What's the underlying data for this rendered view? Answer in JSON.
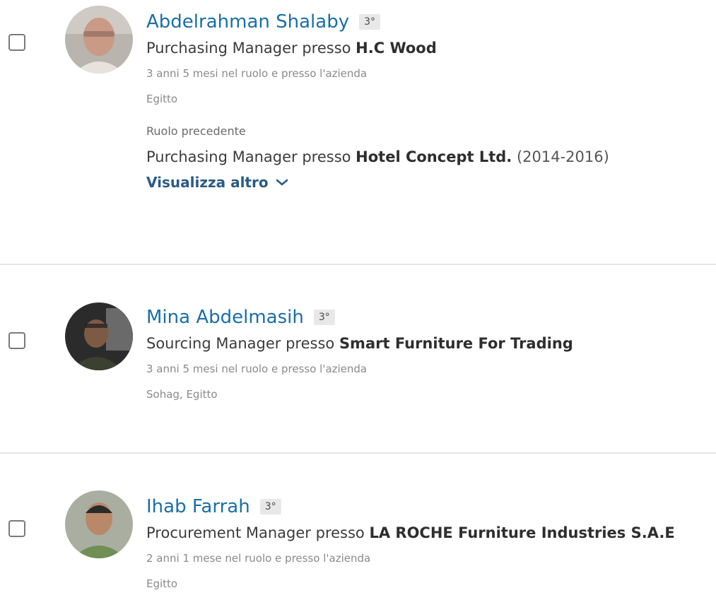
{
  "results": [
    {
      "name": "Abdelrahman Shalaby",
      "degree": "3°",
      "role": "Purchasing Manager",
      "presso": "presso",
      "company": "H.C Wood",
      "tenure": "3 anni 5 mesi nel ruolo e presso l'azienda",
      "location": "Egitto",
      "previous_label": "Ruolo precedente",
      "previous_role": "Purchasing Manager",
      "previous_presso": "presso",
      "previous_company": "Hotel Concept Ltd.",
      "previous_years": "(2014-2016)",
      "show_more": "Visualizza altro"
    },
    {
      "name": "Mina Abdelmasih",
      "degree": "3°",
      "role": "Sourcing Manager",
      "presso": "presso",
      "company": "Smart Furniture For Trading",
      "tenure": "3 anni 5 mesi nel ruolo e presso l'azienda",
      "location": "Sohag, Egitto"
    },
    {
      "name": "Ihab Farrah",
      "degree": "3°",
      "role": "Procurement Manager",
      "presso": "presso",
      "company": "LA ROCHE Furniture Industries S.A.E",
      "tenure": "2 anni 1 mese nel ruolo e presso l'azienda",
      "location": "Egitto"
    }
  ],
  "colors": {
    "name_link": "#1a6fa8",
    "show_more_link": "#2a5b86",
    "divider": "#e6e6e6"
  },
  "icons": {
    "show_more": "chevron-down-icon"
  }
}
